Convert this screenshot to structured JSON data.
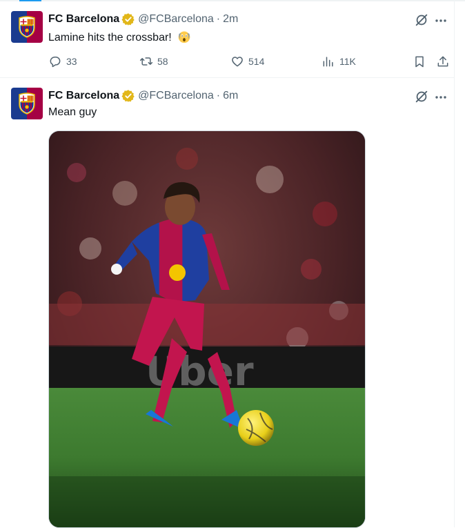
{
  "tweets": [
    {
      "author_name": "FC Barcelona",
      "handle": "@FCBarcelona",
      "separator": "·",
      "time": "2m",
      "text": "Lamine hits the crossbar!",
      "replies": "33",
      "retweets": "58",
      "likes": "514",
      "views": "11K"
    },
    {
      "author_name": "FC Barcelona",
      "handle": "@FCBarcelona",
      "separator": "·",
      "time": "6m",
      "text": "Mean guy",
      "media_text": "Uber"
    }
  ],
  "icons": {
    "verified": "verified-badge-icon",
    "grok": "grok-icon",
    "more": "more-icon",
    "reply": "reply-icon",
    "retweet": "retweet-icon",
    "like": "heart-icon",
    "views": "views-icon",
    "bookmark": "bookmark-icon",
    "share": "share-icon",
    "emoji": "scream-emoji-icon"
  },
  "colors": {
    "text": "#0f1419",
    "secondary": "#536471",
    "accent": "#1d9bf0",
    "verified_gold": "#e2b719",
    "barca_blue": "#1a3b8f",
    "barca_red": "#a50044"
  }
}
